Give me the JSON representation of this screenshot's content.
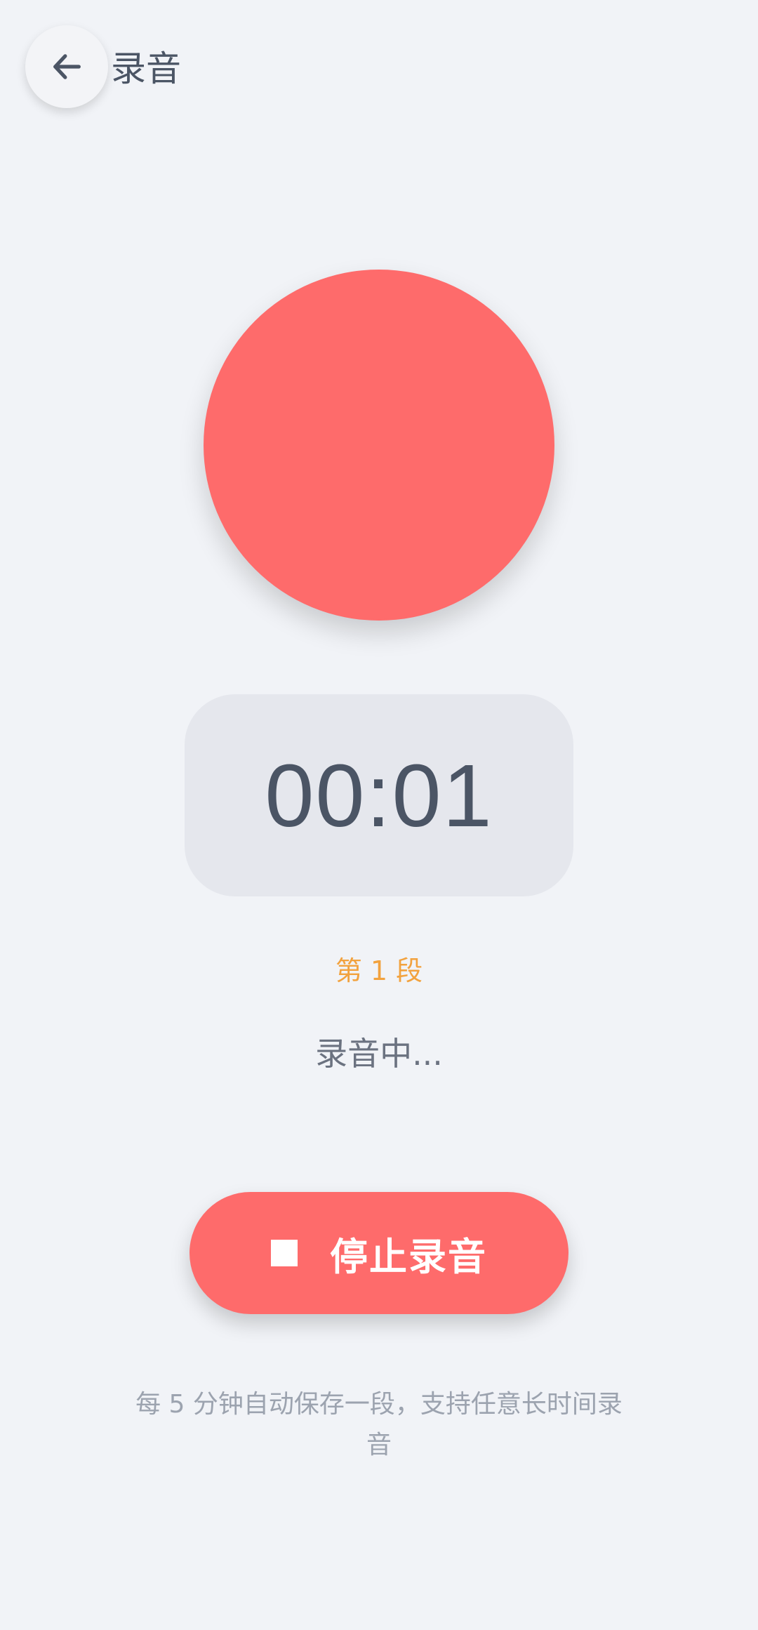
{
  "header": {
    "title": "录音",
    "back_icon": "arrow-left-icon"
  },
  "recorder": {
    "indicator_color": "#fe6b6b",
    "timer": "00:01",
    "segment": "第 1 段",
    "status": "录音中..."
  },
  "controls": {
    "stop_label": "停止录音",
    "stop_icon": "stop-square-icon",
    "accent_color": "#fe6b6b"
  },
  "hint": "每 5 分钟自动保存一段，支持任意长时间录音"
}
